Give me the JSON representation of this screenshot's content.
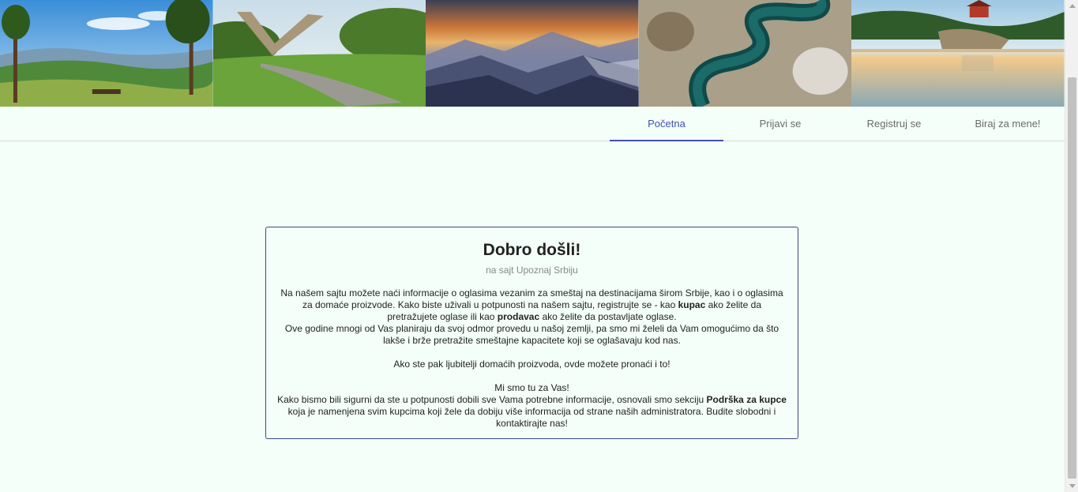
{
  "banner": {
    "images": [
      {
        "name": "mountain-meadow-image"
      },
      {
        "name": "monument-image"
      },
      {
        "name": "misty-mountains-image"
      },
      {
        "name": "river-meander-image"
      },
      {
        "name": "river-house-image"
      }
    ]
  },
  "nav": {
    "tabs": [
      {
        "label": "Početna",
        "active": true
      },
      {
        "label": "Prijavi se",
        "active": false
      },
      {
        "label": "Registruj se",
        "active": false
      },
      {
        "label": "Biraj za mene!",
        "active": false
      }
    ]
  },
  "welcome": {
    "title": "Dobro došli!",
    "subtitle": "na sajt Upoznaj Srbiju",
    "p1_a": "Na našem sajtu možete naći informacije o oglasima vezanim za smeštaj na destinacijama širom Srbije, kao i o oglasima za domaće proizvode. Kako biste uživali u potpunosti na našem sajtu, registrujte se - kao ",
    "p1_b": "kupac",
    "p1_c": " ako želite da pretražujete oglase ili kao ",
    "p1_d": "prodavac",
    "p1_e": " ako želite da postavljate oglase.",
    "p2": "Ove godine mnogi od Vas planiraju da svoj odmor provedu u našoj zemlji, pa smo mi želeli da Vam omogućimo da što lakše i brže pretražite smeštajne kapacitete koji se oglašavaju kod nas.",
    "p3": "Ako ste pak ljubitelji domaćih proizvoda, ovde možete pronaći i to!",
    "p4": "Mi smo tu za Vas!",
    "p5_a": "Kako bismo bili sigurni da ste u potpunosti dobili sve Vama potrebne informacije, osnovali smo sekciju ",
    "p5_b": "Podrška za kupce",
    "p5_c": " koja je namenjena svim kupcima koji žele da dobiju više informacija od strane naših administratora. Budite slobodni i kontaktirajte nas!"
  },
  "colors": {
    "background": "#f4fff9",
    "accent": "#3f51b5",
    "card_border": "#3a4a7a"
  }
}
